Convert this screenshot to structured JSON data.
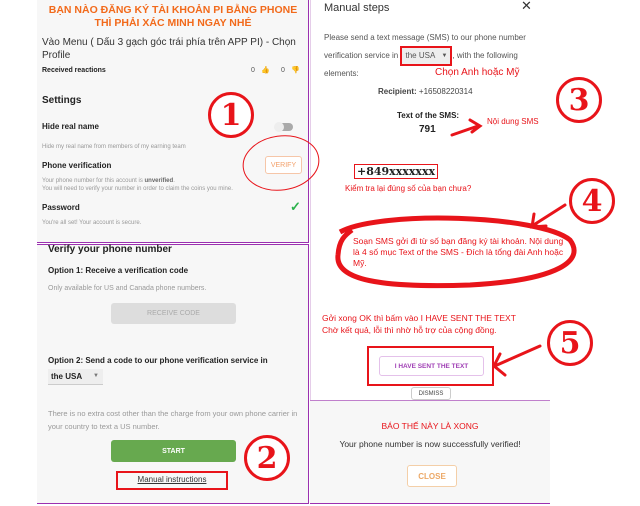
{
  "left_top": {
    "headline": "BẠN NÀO ĐĂNG KÝ TÀI KHOẢN PI BẰNG PHONE THÌ PHẢI XÁC MINH NGAY NHÉ",
    "instruction": "Vào Menu ( Dấu 3 gạch góc trái phía trên APP PI) - Chọn Profile",
    "reactions_label": "Received reactions",
    "likes": "0",
    "dislikes": "0",
    "settings_title": "Settings",
    "hide_name_label": "Hide real name",
    "hide_name_desc": "Hide my real name from members of my earning team",
    "hide_name_on": false,
    "phone_label": "Phone verification",
    "phone_desc_1": "Your phone number for this account is ",
    "phone_status": "unverified",
    "phone_desc_1_end": ".",
    "phone_desc_2": "You will need to verify your number in order to claim the coins you mine.",
    "verify_button": "VERIFY",
    "password_label": "Password",
    "password_desc": "You're all set! Your account is secure."
  },
  "left_bottom": {
    "title": "Verify your phone number",
    "option1": "Option 1: Receive a verification code",
    "option1_desc": "Only available for US and Canada phone numbers.",
    "receive_button": "RECEIVE CODE",
    "option2": "Option 2: Send a code to our phone verification service in",
    "country": "the USA",
    "cost_note": "There is no extra cost other than the charge from your own phone carrier in your country to text a US number.",
    "start_button": "START",
    "manual_link": "Manual instructions"
  },
  "right_top": {
    "title": "Manual steps",
    "desc_1": "Please send a text message (SMS) to our phone number verification service in",
    "country": "the USA",
    "desc_2": ", with the following elements:",
    "recipient_label": "Recipient:",
    "recipient": "+16508220314",
    "sms_label": "Text of the SMS:",
    "sms_code": "791",
    "phone_number": "+849xxxxxxx",
    "sent_button": "I HAVE SENT THE TEXT",
    "dismiss_button": "DISMISS"
  },
  "right_bottom": {
    "done_note": "BÁO THẾ NÀY LÀ XONG",
    "success": "Your phone number is now successfully verified!",
    "close_button": "CLOSE"
  },
  "annotations": {
    "step1": "1",
    "step2": "2",
    "step3": "3",
    "step4": "4",
    "step5": "5",
    "choose_country": "Chọn Anh hoặc Mỹ",
    "sms_content": "Nội dung SMS",
    "check_number": "Kiểm tra lại đúng số của bạn chưa?",
    "compose_note": "Soạn SMS gởi đi từ số bạn đăng ký tài khoản. Nội dung là 4 số mục Text of the SMS - Đích là tổng đài Anh hoặc Mỹ.",
    "sent_note_1": "Gởi xong OK thì bấm vào I HAVE SENT THE TEXT",
    "sent_note_2": "Chờ kết quả, lỗi thì nhờ hỗ trợ của cộng đồng."
  },
  "colors": {
    "accent": "#f26a1b",
    "annotation": "#e8141a",
    "border": "#9b30b0",
    "start": "#67a94f",
    "check": "#2bb24c"
  }
}
